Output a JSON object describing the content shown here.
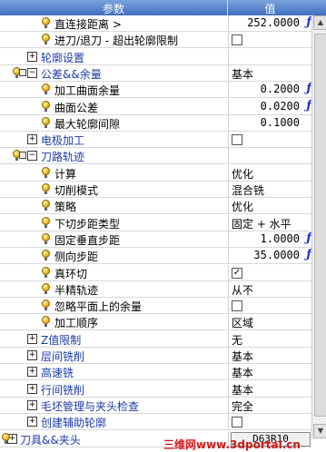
{
  "header": {
    "col_name": "参数",
    "col_value": "值"
  },
  "rows": [
    {
      "label": "直连接距离 >",
      "value": "252.0000",
      "value_kind": "num",
      "formula": true,
      "icon": "bulb",
      "indent": 1
    },
    {
      "label": "进刀/退刀 - 超出轮廓限制",
      "value": "",
      "value_kind": "check",
      "checked": false,
      "icon": "bulb",
      "indent": 1
    },
    {
      "label": "轮廓设置",
      "value": "",
      "value_kind": "empty",
      "icon": "group",
      "indent": 0,
      "expander": "+"
    },
    {
      "label": "公差&&余量",
      "value": "基本",
      "value_kind": "txt",
      "icon": "group-lock",
      "indent": 0,
      "expander": "-"
    },
    {
      "label": "加工曲面余量",
      "value": "0.2000",
      "value_kind": "num",
      "formula": true,
      "icon": "bulb",
      "indent": 1
    },
    {
      "label": "曲面公差",
      "value": "0.0200",
      "value_kind": "num",
      "formula": true,
      "icon": "bulb",
      "indent": 1
    },
    {
      "label": "最大轮廓间隙",
      "value": "0.1000",
      "value_kind": "num",
      "formula": false,
      "icon": "bulb",
      "indent": 1
    },
    {
      "label": "电极加工",
      "value": "",
      "value_kind": "check",
      "checked": false,
      "icon": "group",
      "indent": 0,
      "expander": "+"
    },
    {
      "label": "刀路轨迹",
      "value": "",
      "value_kind": "empty",
      "icon": "group-lock",
      "indent": 0,
      "expander": "-"
    },
    {
      "label": "计算",
      "value": "优化",
      "value_kind": "txt",
      "icon": "bulb",
      "indent": 1
    },
    {
      "label": "切削模式",
      "value": "混合铣",
      "value_kind": "txt",
      "icon": "bulb",
      "indent": 1
    },
    {
      "label": "策略",
      "value": "优化",
      "value_kind": "txt",
      "icon": "bulb",
      "indent": 1
    },
    {
      "label": "下切步距类型",
      "value": "固定 + 水平",
      "value_kind": "txt",
      "icon": "bulb",
      "indent": 1
    },
    {
      "label": "固定垂直步距",
      "value": "1.0000",
      "value_kind": "num",
      "formula": true,
      "icon": "bulb",
      "indent": 1
    },
    {
      "label": "侧向步距",
      "value": "35.0000",
      "value_kind": "num",
      "formula": true,
      "icon": "bulb",
      "indent": 1
    },
    {
      "label": "真环切",
      "value": "",
      "value_kind": "check",
      "checked": true,
      "icon": "bulb",
      "indent": 1
    },
    {
      "label": "半精轨迹",
      "value": "从不",
      "value_kind": "txt",
      "icon": "bulb",
      "indent": 1
    },
    {
      "label": "忽略平面上的余量",
      "value": "",
      "value_kind": "check",
      "checked": false,
      "icon": "bulb",
      "indent": 1
    },
    {
      "label": "加工顺序",
      "value": "区域",
      "value_kind": "txt",
      "icon": "bulb",
      "indent": 1
    },
    {
      "label": "Z值限制",
      "value": "无",
      "value_kind": "txt",
      "icon": "group",
      "indent": 0,
      "expander": "+"
    },
    {
      "label": "层间铣削",
      "value": "基本",
      "value_kind": "txt",
      "icon": "group",
      "indent": 0,
      "expander": "+"
    },
    {
      "label": "高速铣",
      "value": "基本",
      "value_kind": "txt",
      "icon": "group",
      "indent": 0,
      "expander": "+"
    },
    {
      "label": "行间铣削",
      "value": "基本",
      "value_kind": "txt",
      "icon": "group",
      "indent": 0,
      "expander": "+"
    },
    {
      "label": "毛坯管理与夹头检查",
      "value": "完全",
      "value_kind": "txt",
      "icon": "group",
      "indent": 0,
      "expander": "+"
    },
    {
      "label": "创建辅助轮廓",
      "value": "",
      "value_kind": "check",
      "checked": false,
      "icon": "group",
      "indent": 0,
      "expander": "+"
    },
    {
      "label": "刀具&&夹头",
      "value": "D63R10",
      "value_kind": "button",
      "icon": "top-group",
      "indent": -1,
      "expander": "+"
    }
  ],
  "watermark": "三维网www.3dportal.cn",
  "colors": {
    "formula": "#1a2ad8",
    "group_text": "#1a3aa8",
    "header": "#3f6fbe"
  }
}
